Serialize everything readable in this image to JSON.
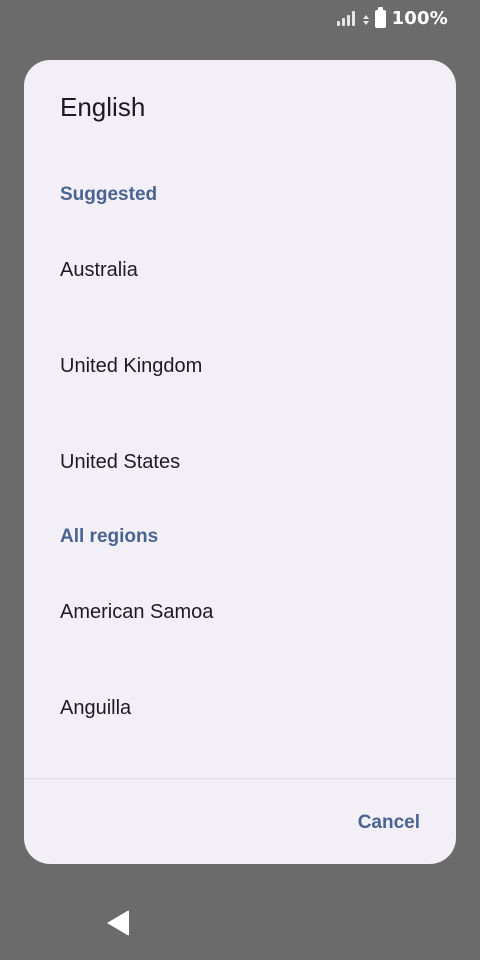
{
  "status_bar": {
    "battery_text": "100%",
    "icons": [
      "signal-icon",
      "data-transfer-icon",
      "battery-icon"
    ]
  },
  "dialog": {
    "title": "English",
    "sections": [
      {
        "header": "Suggested",
        "items": [
          "Australia",
          "United Kingdom",
          "United States"
        ]
      },
      {
        "header": "All regions",
        "items": [
          "American Samoa",
          "Anguilla"
        ]
      }
    ],
    "cancel_label": "Cancel"
  },
  "navigation": {
    "icons": [
      "back-icon"
    ]
  },
  "colors": {
    "scrim": "#6b6b6b",
    "dialog_background": "#f2f0f6",
    "accent": "#4a6390",
    "text_primary": "#1c1b1f"
  }
}
